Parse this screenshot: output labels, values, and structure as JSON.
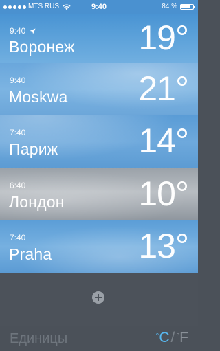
{
  "status_bar": {
    "carrier": "MTS RUS",
    "time": "9:40",
    "battery_text": "84 %",
    "battery_level": 0.84,
    "signal_bars": 5
  },
  "cities": [
    {
      "time": "9:40",
      "name": "Воронеж",
      "temp": "19°",
      "is_current_location": true
    },
    {
      "time": "9:40",
      "name": "Moskwa",
      "temp": "21°"
    },
    {
      "time": "7:40",
      "name": "Париж",
      "temp": "14°"
    },
    {
      "time": "6:40",
      "name": "Лондон",
      "temp": "10°"
    },
    {
      "time": "7:40",
      "name": "Praha",
      "temp": "13°"
    }
  ],
  "add_button": {
    "icon": "plus-circle-icon"
  },
  "units": {
    "label": "Единицы",
    "celsius": "C",
    "separator": "/",
    "fahrenheit": "F",
    "degree": "°",
    "active": "C",
    "active_color": "#58b8f0"
  }
}
